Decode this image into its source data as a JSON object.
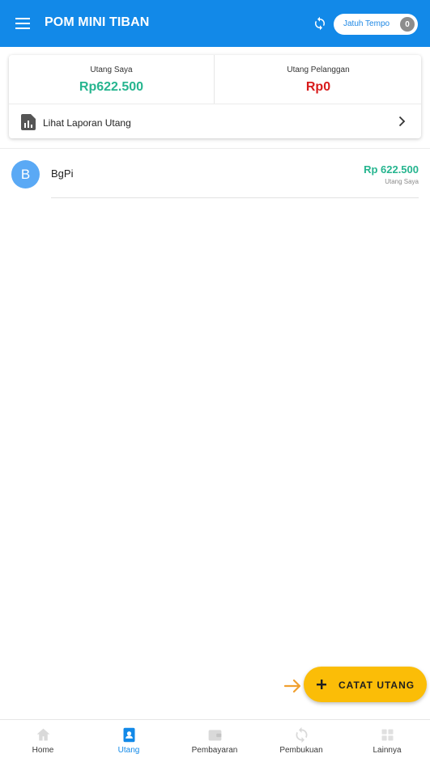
{
  "appbar": {
    "title": "POM MINI TIBAN",
    "menu_icon": "menu-icon",
    "sync_icon": "sync-icon",
    "due_label": "Jatuh Tempo",
    "due_count": "0"
  },
  "summary": {
    "my_debt_label": "Utang Saya",
    "my_debt_value": "Rp622.500",
    "customer_debt_label": "Utang Pelanggan",
    "customer_debt_value": "Rp0",
    "report_label": "Lihat Laporan Utang"
  },
  "debts": [
    {
      "initial": "B",
      "name": "BgPi",
      "amount": "Rp 622.500",
      "type": "Utang Saya"
    }
  ],
  "fab": {
    "label": "CATAT UTANG"
  },
  "nav": [
    {
      "label": "Home",
      "icon": "home-icon",
      "active": false
    },
    {
      "label": "Utang",
      "icon": "contact-book-icon",
      "active": true
    },
    {
      "label": "Pembayaran",
      "icon": "wallet-icon",
      "active": false
    },
    {
      "label": "Pembukuan",
      "icon": "sync-icon",
      "active": false
    },
    {
      "label": "Lainnya",
      "icon": "grid-icon",
      "active": false
    }
  ],
  "colors": {
    "primary": "#1289e8",
    "green": "#26b58f",
    "red": "#d81b1b",
    "fab": "#fbbd07",
    "hint_arrow": "#f0a030",
    "inactive_icon": "#dddddd"
  }
}
